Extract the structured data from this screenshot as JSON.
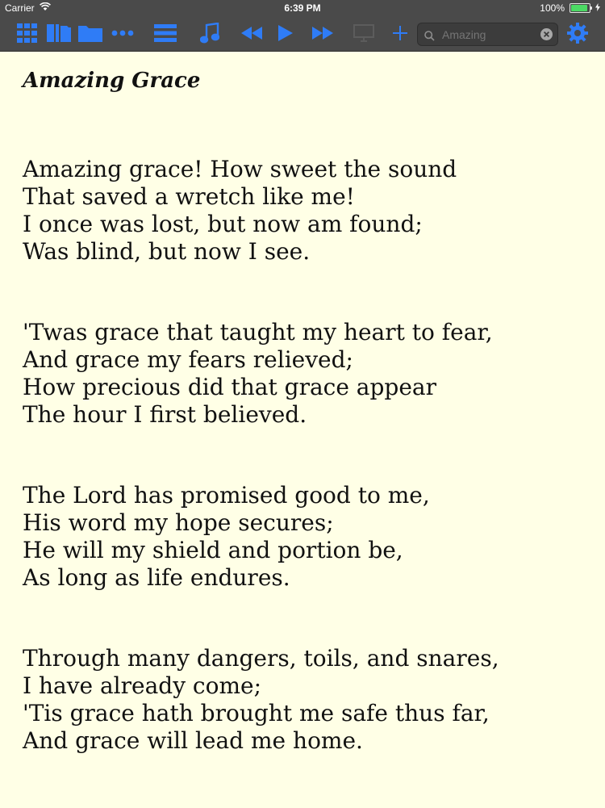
{
  "status_bar": {
    "carrier": "Carrier",
    "time": "6:39 PM",
    "battery": "100%"
  },
  "toolbar": {
    "icons": [
      "grid-icon",
      "library-icon",
      "folder-icon",
      "more-icon",
      "list-icon",
      "music-note-icon",
      "rewind-icon",
      "play-icon",
      "fast-forward-icon",
      "display-icon",
      "add-icon",
      "gear-icon"
    ],
    "accent_color": "#2f7cf6",
    "disabled_color": "#5c5c5c"
  },
  "search": {
    "placeholder": "Amazing",
    "value": ""
  },
  "song": {
    "title": "Amazing Grace",
    "stanzas": [
      {
        "lines": [
          "Amazing grace! How sweet the sound",
          "That saved a wretch like me!",
          "I once was lost, but now am found;",
          "Was blind, but now I see."
        ]
      },
      {
        "lines": [
          "'Twas grace that taught my heart to fear,",
          "And grace my fears relieved;",
          "How precious did that grace appear",
          "The hour I first believed."
        ]
      },
      {
        "lines": [
          "The Lord has promised good to me,",
          "His word my hope secures;",
          "He will my shield and portion be,",
          "As long as life endures."
        ]
      },
      {
        "lines": [
          "Through many dangers, toils, and snares,",
          "I have already come;",
          "'Tis grace hath brought me safe thus far,",
          "And grace will lead me home."
        ]
      }
    ]
  }
}
